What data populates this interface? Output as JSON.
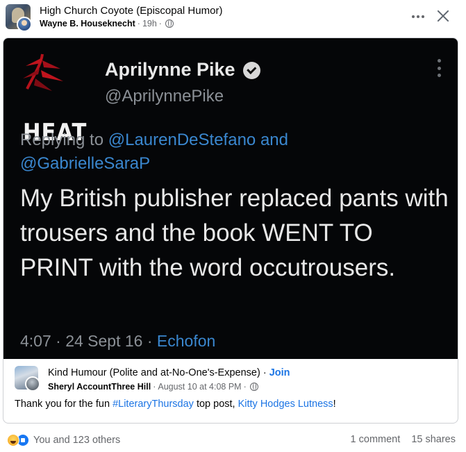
{
  "post": {
    "group_name": "High Church Coyote (Episcopal Humor)",
    "author": "Wayne B. Houseknecht",
    "time": "19h",
    "separator": "·"
  },
  "tweet": {
    "logo_text": "HEAT",
    "name": "Aprilynne Pike",
    "handle": "@AprilynnePike",
    "replying_prefix": "Replying to",
    "mention_1": "@LaurenDeStefano",
    "and_word": "and",
    "mention_2": "@GabrielleSaraP",
    "body": "My British publisher replaced pants with trousers and the book WENT TO PRINT with the word occutrousers.",
    "time": "4:07 · 24 Sept 16 ·",
    "source": "Echofon"
  },
  "shared": {
    "group_name": "Kind Humour (Polite and at-No-One's-Expense)",
    "separator": "·",
    "join_label": "Join",
    "author": "Sheryl AccountThree Hill",
    "time": "August 10 at 4:08 PM",
    "text_before": "Thank you for the fun ",
    "hashtag": "#LiteraryThursday",
    "text_mid": " top post, ",
    "mention": "Kitty Hodges Lutness",
    "text_after": "!"
  },
  "footer": {
    "reactions_text": "You and 123 others",
    "comments": "1 comment",
    "shares": "15 shares"
  },
  "colors": {
    "link": "#1b74e4",
    "tweet_link": "#3a87cf",
    "secondary_text": "#65676b"
  },
  "icons": [
    "more-horizontal-icon",
    "close-icon",
    "globe-icon",
    "verified-icon",
    "haha-reaction-icon",
    "like-reaction-icon"
  ]
}
